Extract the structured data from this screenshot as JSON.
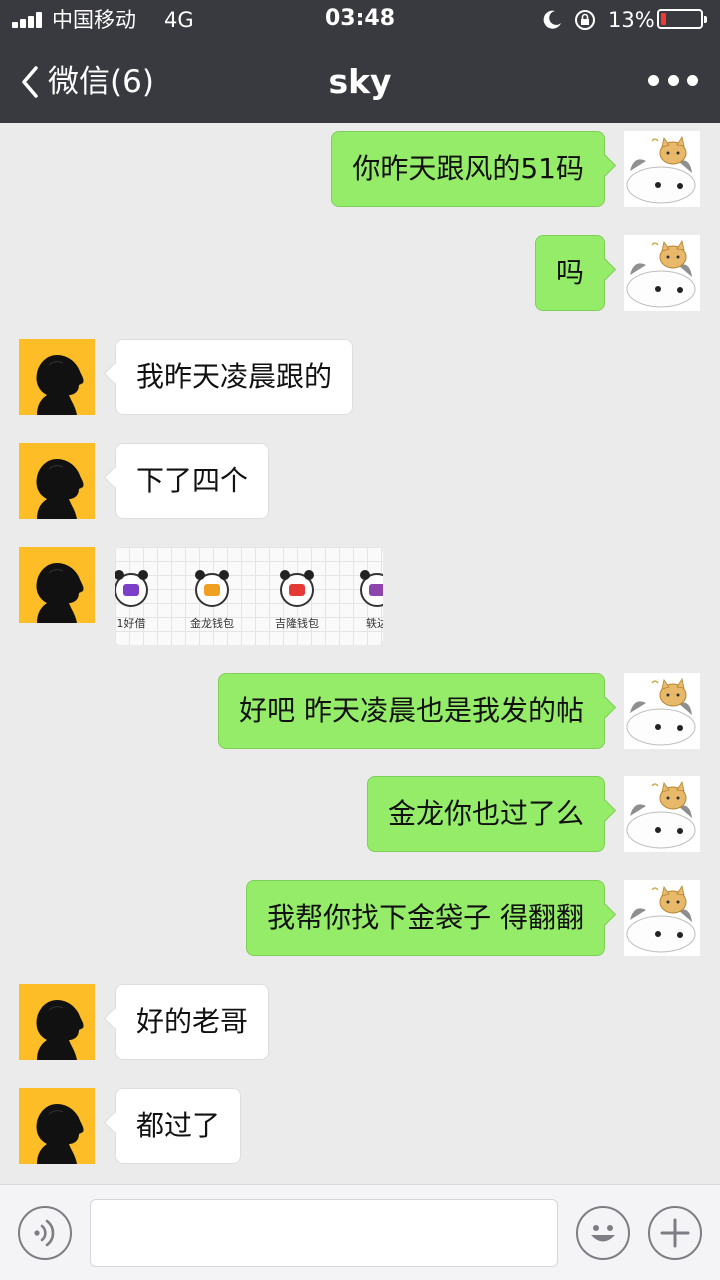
{
  "status_bar": {
    "carrier": "中国移动",
    "network": "4G",
    "time": "03:48",
    "battery_percent": "13%",
    "battery_level": 0.13,
    "battery_color": "#f23a33",
    "icons": [
      "signal-icon",
      "moon-icon",
      "rotation-lock-icon",
      "battery-icon"
    ]
  },
  "nav": {
    "back_label": "微信(6)",
    "title": "sky",
    "more_icon": "more-dots-icon"
  },
  "colors": {
    "outgoing_bubble": "#95ec69",
    "incoming_bubble": "#ffffff",
    "chat_background": "#ebebeb",
    "nav_background": "#393a3f",
    "contact_avatar_background": "#fcbd27"
  },
  "messages": [
    {
      "side": "right",
      "type": "text",
      "text": "你昨天跟风的51码"
    },
    {
      "side": "right",
      "type": "text",
      "text": "吗"
    },
    {
      "side": "left",
      "type": "text",
      "text": "我昨天凌晨跟的"
    },
    {
      "side": "left",
      "type": "text",
      "text": "下了四个"
    },
    {
      "side": "left",
      "type": "image",
      "apps": [
        {
          "label": "1好借",
          "color": "#7b3fc9"
        },
        {
          "label": "金龙钱包",
          "color": "#f0a020"
        },
        {
          "label": "吉隆钱包",
          "color": "#e53935"
        },
        {
          "label": "轶达",
          "color": "#8e44ad"
        }
      ]
    },
    {
      "side": "right",
      "type": "text",
      "text": "好吧 昨天凌晨也是我发的帖"
    },
    {
      "side": "right",
      "type": "text",
      "text": "金龙你也过了么"
    },
    {
      "side": "right",
      "type": "text",
      "text": "我帮你找下金袋子 得翻翻"
    },
    {
      "side": "left",
      "type": "text",
      "text": "好的老哥"
    },
    {
      "side": "left",
      "type": "text",
      "text": "都过了"
    }
  ],
  "input_bar": {
    "voice_icon": "voice-icon",
    "input_value": "",
    "emoji_icon": "emoji-icon",
    "plus_icon": "plus-icon"
  }
}
